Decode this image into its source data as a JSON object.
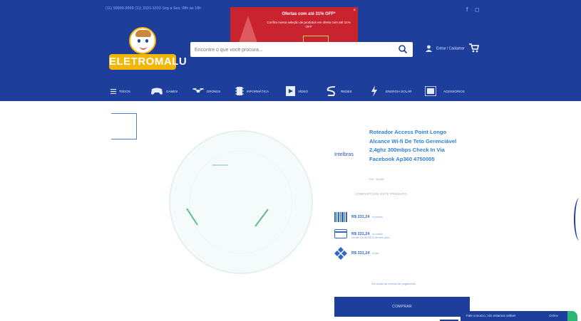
{
  "header": {
    "contact": "(11) 99999-9999   (11) 3333-3333   Seg a Sex: 08h às 18h",
    "promo": {
      "title": "Ofertas com até 31% OFF*",
      "subtitle": "Confira nossa seleção de produtos em oferta com até 31% OFF",
      "close": "×"
    },
    "logo_text": "ELETROMALU",
    "search_placeholder": "Encontre o que você procura...",
    "account_label": "Entrar / Cadastrar"
  },
  "nav": [
    {
      "label": "TODOS",
      "icon": "hamburger-icon"
    },
    {
      "label": "GAMES",
      "icon": "gamepad-icon"
    },
    {
      "label": "DRONES",
      "icon": "drone-icon"
    },
    {
      "label": "INFORMÁTICA",
      "icon": "chip-icon"
    },
    {
      "label": "VÍDEO",
      "icon": "film-icon"
    },
    {
      "label": "REDES",
      "icon": "wifi-icon"
    },
    {
      "label": "ENERGIA SOLAR",
      "icon": "bolt-icon"
    },
    {
      "label": "ACESSÓRIOS",
      "icon": "accessory-icon"
    }
  ],
  "product": {
    "vendor": "Intelbras",
    "title": "Roteador Access Point Longo Alcance Wi-fi De Teto Gerenciável 2,4ghz 300mbps Check In Via Facebook Ap360 4750005",
    "sku": "Ref.: Ap360",
    "share_text": "COMPARTILHE ESTE PRODUTO",
    "prices": [
      {
        "method": "boleto",
        "icon": "barcode-icon",
        "value": "R$ 331,24",
        "suffix": "no boleto"
      },
      {
        "method": "cartao",
        "icon": "card-icon",
        "value": "R$ 331,24",
        "suffix": "no cartão",
        "detail": "em até 12x de R$ 27,60 sem juros"
      },
      {
        "method": "pix",
        "icon": "pix-icon",
        "value": "R$ 331,24",
        "suffix": "no pix"
      }
    ],
    "payment_link": "Ver todas as formas de pagamento",
    "buy_label": "COMPRAR"
  },
  "chat": {
    "text": "Fale conosco, nós estamos online!",
    "online": "Online"
  },
  "colors": {
    "brand_blue": "#1e3e9c",
    "promo_red": "#c8232e",
    "logo_yellow": "#f2b705",
    "title_blue": "#2f7fd9",
    "whatsapp_green": "#2bb673"
  }
}
